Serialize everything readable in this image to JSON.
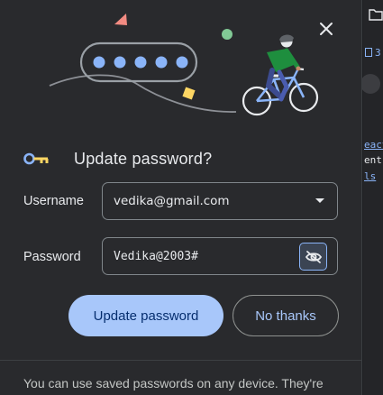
{
  "dialog": {
    "title": "Update password?",
    "close_label": "Close"
  },
  "form": {
    "username_label": "Username",
    "username_value": "vedika@gmail.com",
    "password_label": "Password",
    "password_value": "Vedika@2003#"
  },
  "actions": {
    "primary_label": "Update password",
    "secondary_label": "No thanks"
  },
  "footer": {
    "text": "You can use saved passwords on any device. They're"
  },
  "background": {
    "tab_number": "3",
    "code_line_1": "eact",
    "code_line_2": "ent",
    "code_line_3": "ls"
  },
  "colors": {
    "dialog_bg": "#292a2d",
    "primary_button": "#a8c7fa",
    "accent": "#8ab4f8",
    "text": "#e8eaed"
  },
  "icons": {
    "close": "close-icon",
    "key": "key-icon",
    "dropdown": "chevron-down-icon",
    "visibility": "eye-off-icon",
    "folder": "folder-icon",
    "hero": "cyclist-illustration"
  }
}
